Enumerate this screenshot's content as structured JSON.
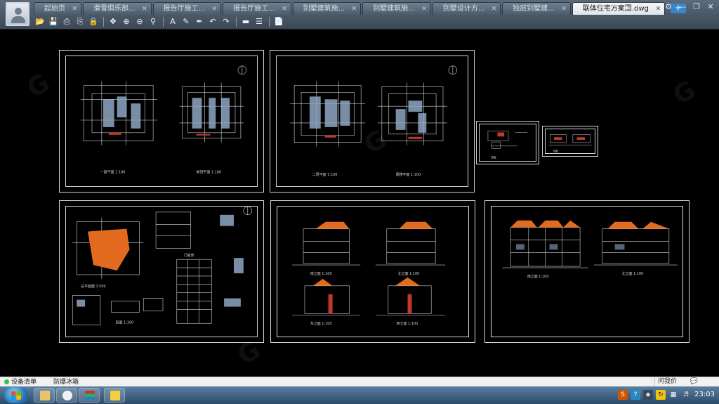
{
  "tabs": [
    {
      "label": "起始页",
      "active": false
    },
    {
      "label": "滑雪俱乐部...",
      "active": false
    },
    {
      "label": "报告厅施工...",
      "active": false
    },
    {
      "label": "报告厅施工...",
      "active": false
    },
    {
      "label": "别墅建筑施...",
      "active": false
    },
    {
      "label": "别墅建筑施...",
      "active": false
    },
    {
      "label": "别墅设计方...",
      "active": false
    },
    {
      "label": "独层别墅建...",
      "active": false
    },
    {
      "label": "联体住宅方案图.dwg",
      "active": true
    }
  ],
  "tab_add_label": "+",
  "window_controls": [
    "user-icon",
    "share-icon",
    "cloud-icon",
    "message-icon",
    "pin-icon",
    "settings-icon",
    "minimize-icon",
    "restore-icon",
    "close-icon"
  ],
  "toolbar_icons": [
    "open-icon",
    "save-icon",
    "print-icon",
    "lock-print-icon",
    "lock-icon",
    "zoom-pan-icon",
    "zoom-in-icon",
    "zoom-out-icon",
    "zoom-window-icon",
    "text-icon",
    "pencil-icon",
    "pen-icon",
    "undo-icon",
    "redo-icon",
    "measure-icon",
    "layers-icon",
    "export-icon"
  ],
  "sheets": [
    {
      "id": "sheet-1",
      "captions": [
        "一层平面 1:100",
        "屋顶平面 1:100"
      ]
    },
    {
      "id": "sheet-2",
      "captions": [
        "二层平面 1:100",
        "阁楼平面 1:100"
      ]
    },
    {
      "id": "sheet-3",
      "captions": [
        "详图"
      ]
    },
    {
      "id": "sheet-4",
      "captions": [
        "详图"
      ]
    },
    {
      "id": "sheet-5",
      "captions": [
        "总平面图 1:500",
        "门窗表",
        "剖面 1:100"
      ]
    },
    {
      "id": "sheet-6",
      "captions": [
        "南立面 1:100",
        "北立面 1:100",
        "东立面 1:100",
        "西立面 1:100"
      ]
    },
    {
      "id": "sheet-7",
      "captions": [
        "南立面 1:100",
        "北立面 1:100"
      ]
    }
  ],
  "statusbar": {
    "devices_label": "设备清单",
    "fire_label": "防爆冰箱",
    "help_label": "问我价",
    "chat_label": "💬"
  },
  "taskbar": {
    "clock": "23:03"
  },
  "colors": {
    "line": "#d6d6d6",
    "accent_orange": "#e36b1f",
    "accent_blue": "#8fa7c4",
    "accent_red": "#c0392b"
  }
}
